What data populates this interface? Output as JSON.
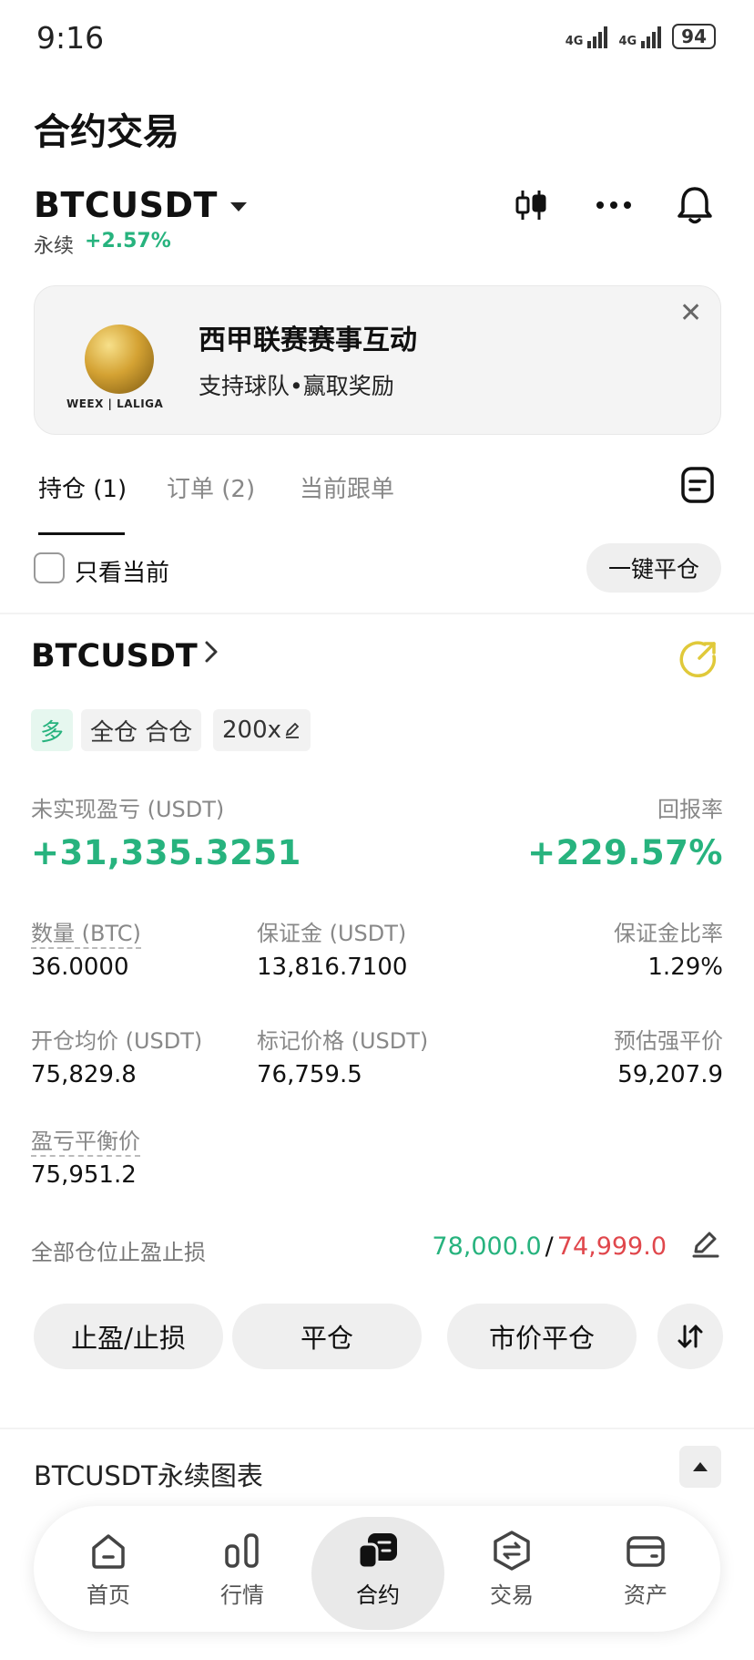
{
  "status_bar": {
    "time": "9:16",
    "network_1": "4G",
    "network_2": "4G",
    "battery": "94"
  },
  "page_title": "合约交易",
  "header": {
    "symbol": "BTCUSDT",
    "type": "永续",
    "change": "+2.57%",
    "icons": [
      "candlestick-icon",
      "more-icon",
      "bell-icon"
    ]
  },
  "banner": {
    "title": "西甲联赛赛事互动",
    "subtitle": "支持球队•赢取奖励",
    "logo_text": "WEEX | LALIGA"
  },
  "tabs": [
    {
      "label": "持仓 (1)",
      "active": true
    },
    {
      "label": "订单 (2)",
      "active": false
    },
    {
      "label": "当前跟单",
      "active": false
    }
  ],
  "filter": {
    "only_current_label": "只看当前",
    "close_all_label": "一键平仓"
  },
  "position": {
    "symbol": "BTCUSDT",
    "tags": {
      "side": "多",
      "margin_mode": "全仓 合仓",
      "leverage": "200x"
    },
    "unrealized_pnl_label": "未实现盈亏 (USDT)",
    "unrealized_pnl": "+31,335.3251",
    "roe_label": "回报率",
    "roe": "+229.57%",
    "fields": {
      "qty_label": "数量 (BTC)",
      "qty": "36.0000",
      "margin_label": "保证金 (USDT)",
      "margin": "13,816.7100",
      "margin_ratio_label": "保证金比率",
      "margin_ratio": "1.29%",
      "entry_label": "开仓均价 (USDT)",
      "entry": "75,829.8",
      "mark_label": "标记价格 (USDT)",
      "mark": "76,759.5",
      "liq_label": "预估强平价",
      "liq": "59,207.9",
      "breakeven_label": "盈亏平衡价",
      "breakeven": "75,951.2"
    },
    "tpsl_label": "全部仓位止盈止损",
    "tp": "78,000.0",
    "tpsl_sep": "/",
    "sl": "74,999.0"
  },
  "actions": {
    "tpsl": "止盈/止损",
    "close": "平仓",
    "market_close": "市价平仓"
  },
  "chart_section": {
    "title": "BTCUSDT永续图表"
  },
  "nav": [
    {
      "label": "首页",
      "icon": "home-icon"
    },
    {
      "label": "行情",
      "icon": "market-icon"
    },
    {
      "label": "合约",
      "icon": "futures-icon",
      "active": true
    },
    {
      "label": "交易",
      "icon": "trade-icon"
    },
    {
      "label": "资产",
      "icon": "wallet-icon"
    }
  ],
  "colors": {
    "green": "#27b37e",
    "red": "#e0474c",
    "share_icon": "#e0c93a"
  }
}
